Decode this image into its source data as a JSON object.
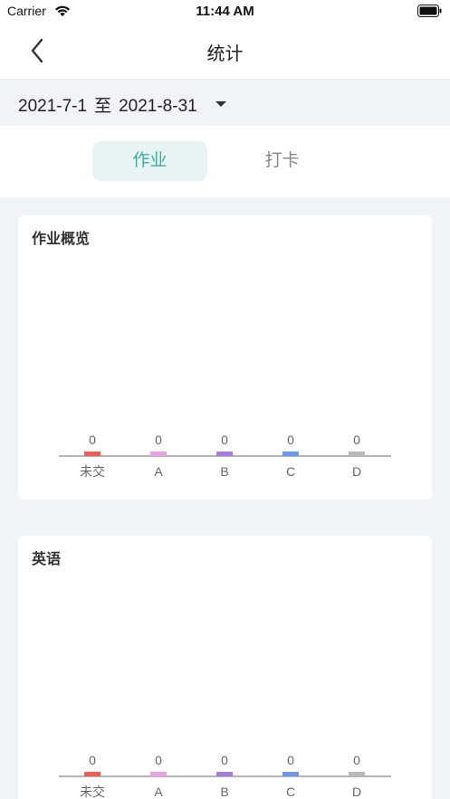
{
  "status": {
    "carrier": "Carrier",
    "time": "11:44 AM"
  },
  "header": {
    "title": "统计"
  },
  "date_range": {
    "start": "2021-7-1",
    "separator": "至",
    "end": "2021-8-31"
  },
  "tabs": [
    {
      "label": "作业",
      "active": true
    },
    {
      "label": "打卡",
      "active": false
    }
  ],
  "colors": {
    "accent": "#3fa9a0",
    "tab_active_bg": "#e7f4f3"
  },
  "chart_data": [
    {
      "type": "bar",
      "title": "作业概览",
      "categories": [
        "未交",
        "A",
        "B",
        "C",
        "D"
      ],
      "values": [
        0,
        0,
        0,
        0,
        0
      ],
      "colors": [
        "#f25c54",
        "#e8a3e0",
        "#a57ce0",
        "#6b9be8",
        "#b7b9bd"
      ]
    },
    {
      "type": "bar",
      "title": "英语",
      "categories": [
        "未交",
        "A",
        "B",
        "C",
        "D"
      ],
      "values": [
        0,
        0,
        0,
        0,
        0
      ],
      "colors": [
        "#f25c54",
        "#e8a3e0",
        "#a57ce0",
        "#6b9be8",
        "#b7b9bd"
      ]
    }
  ]
}
